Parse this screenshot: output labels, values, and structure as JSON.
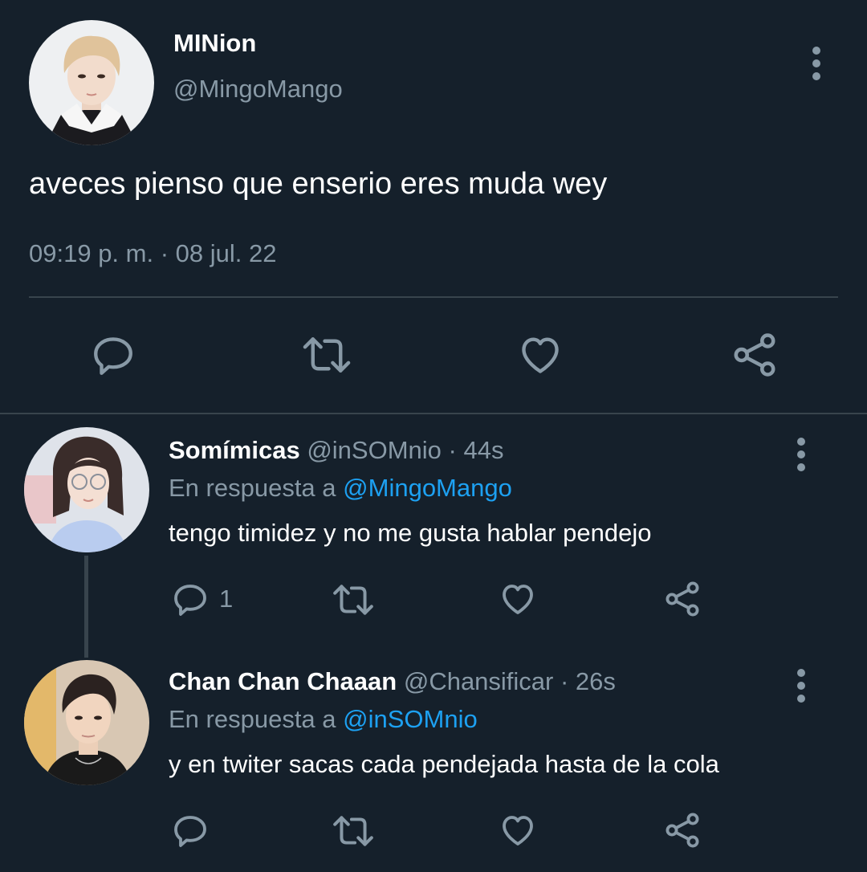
{
  "main_tweet": {
    "display_name": "MINion",
    "handle": "@MingoMango",
    "text": "aveces pienso que enserio eres muda wey",
    "timestamp": "09:19 p. m. · 08 jul. 22"
  },
  "replies": [
    {
      "display_name": "Somímicas",
      "handle": "@inSOMnio",
      "age": "· 44s",
      "reply_prefix": "En respuesta a",
      "reply_to": "@MingoMango",
      "text": "tengo timidez y no me gusta hablar pendejo",
      "reply_count": "1"
    },
    {
      "display_name": "Chan Chan Chaaan",
      "handle": "@Chansificar",
      "age": "· 26s",
      "reply_prefix": "En respuesta a",
      "reply_to": "@inSOMnio",
      "text": "y en twiter sacas cada pendejada hasta de la cola",
      "reply_count": ""
    }
  ],
  "icons": [
    "reply-icon",
    "retweet-icon",
    "like-icon",
    "share-icon",
    "more-icon"
  ],
  "colors": {
    "background": "#15202b",
    "muted": "#8899a6",
    "link": "#1da1f2",
    "divider": "#38444d"
  }
}
